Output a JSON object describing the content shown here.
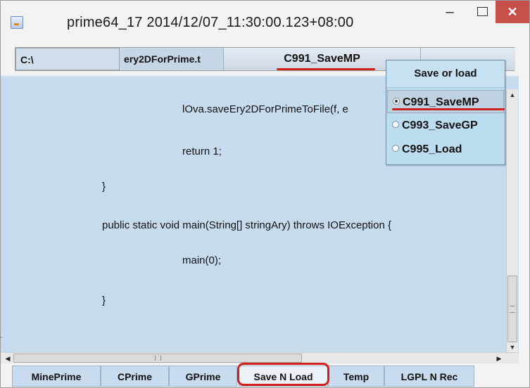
{
  "window": {
    "title": "prime64_17  2014/12/07_11:30:00.123+08:00",
    "minimize_glyph": "–",
    "close_glyph": "✕",
    "accent_close": "#c7504a"
  },
  "top_fields": {
    "path": "C:\\",
    "file": "ery2DForPrime.t",
    "selected_action": "C991_SaveMP",
    "extra": ""
  },
  "code": {
    "lines": [
      "lOva.saveEry2DForPrimeToFile(f, e",
      "return 1;",
      "}",
      "public static void main(String[] stringAry) throws IOException {",
      "main(0);",
      "}",
      "}"
    ]
  },
  "popup": {
    "title": "Save or load",
    "options": [
      {
        "label": "C991_SaveMP",
        "selected": true
      },
      {
        "label": "C993_SaveGP",
        "selected": false
      },
      {
        "label": "C995_Load",
        "selected": false
      }
    ]
  },
  "tabs": [
    {
      "label": "MinePrime"
    },
    {
      "label": "CPrime"
    },
    {
      "label": "GPrime"
    },
    {
      "label": "Save N Load",
      "active": true
    },
    {
      "label": "Temp"
    },
    {
      "label": "LGPL N Rec"
    }
  ],
  "colors": {
    "highlight_red": "#d0201a",
    "code_background": "#c7dbef",
    "popup_background": "#bcdcef"
  }
}
